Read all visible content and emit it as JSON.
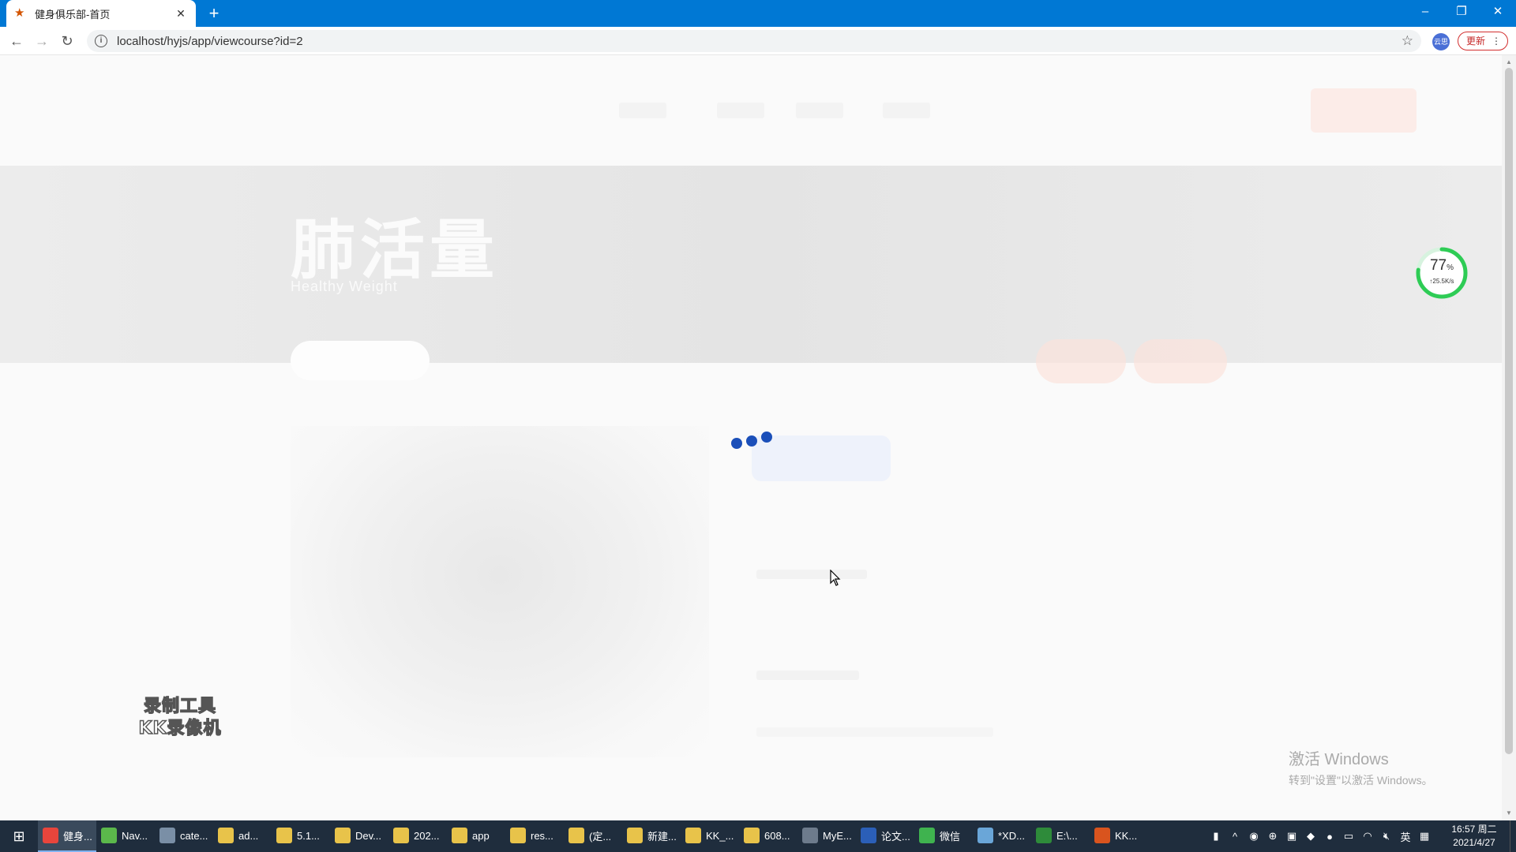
{
  "browser": {
    "tab_title": "健身俱乐部-首页",
    "tab_favicon": "star-favicon",
    "url": "localhost/hyjs/app/viewcourse?id=2",
    "update_label": "更新",
    "extension_label": "云思"
  },
  "page": {
    "hero_title": "肺活量",
    "hero_subtitle": "Healthy Weight",
    "loading": "three-dot-spinner"
  },
  "speed_widget": {
    "percent": "77",
    "percent_unit": "%",
    "speed": "↑25.5K/s"
  },
  "recording_watermark": {
    "line1": "录制工具",
    "line2": "KK录像机"
  },
  "windows_activation": {
    "line1": "激活 Windows",
    "line2": "转到\"设置\"以激活 Windows。"
  },
  "taskbar": {
    "items": [
      {
        "label": "健身...",
        "icon": "chrome-icon",
        "color": "#e8453c"
      },
      {
        "label": "Nav...",
        "icon": "navicat-icon",
        "color": "#5bb84b"
      },
      {
        "label": "cate...",
        "icon": "app-icon",
        "color": "#7a8fa6"
      },
      {
        "label": "ad...",
        "icon": "folder-icon",
        "color": "#e8c34a"
      },
      {
        "label": "5.1...",
        "icon": "folder-icon",
        "color": "#e8c34a"
      },
      {
        "label": "Dev...",
        "icon": "folder-icon",
        "color": "#e8c34a"
      },
      {
        "label": "202...",
        "icon": "folder-icon",
        "color": "#e8c34a"
      },
      {
        "label": "app",
        "icon": "folder-icon",
        "color": "#e8c34a"
      },
      {
        "label": "res...",
        "icon": "folder-icon",
        "color": "#e8c34a"
      },
      {
        "label": "(定...",
        "icon": "folder-icon",
        "color": "#e8c34a"
      },
      {
        "label": "新建...",
        "icon": "folder-icon",
        "color": "#e8c34a"
      },
      {
        "label": "KK_...",
        "icon": "folder-icon",
        "color": "#e8c34a"
      },
      {
        "label": "608...",
        "icon": "folder-icon",
        "color": "#e8c34a"
      },
      {
        "label": "MyE...",
        "icon": "myeclipse-icon",
        "color": "#6d7b8c"
      },
      {
        "label": "论文...",
        "icon": "word-icon",
        "color": "#2b5fb8"
      },
      {
        "label": "微信",
        "icon": "wechat-icon",
        "color": "#3fb34f"
      },
      {
        "label": "*XD...",
        "icon": "notepad-icon",
        "color": "#6aa6d8"
      },
      {
        "label": "E:\\...",
        "icon": "excel-icon",
        "color": "#2e8b3a"
      },
      {
        "label": "KK...",
        "icon": "kk-recorder-icon",
        "color": "#d9541e"
      }
    ],
    "tray": {
      "ime": "英",
      "time": "16:57 周二",
      "date": "2021/4/27"
    }
  }
}
